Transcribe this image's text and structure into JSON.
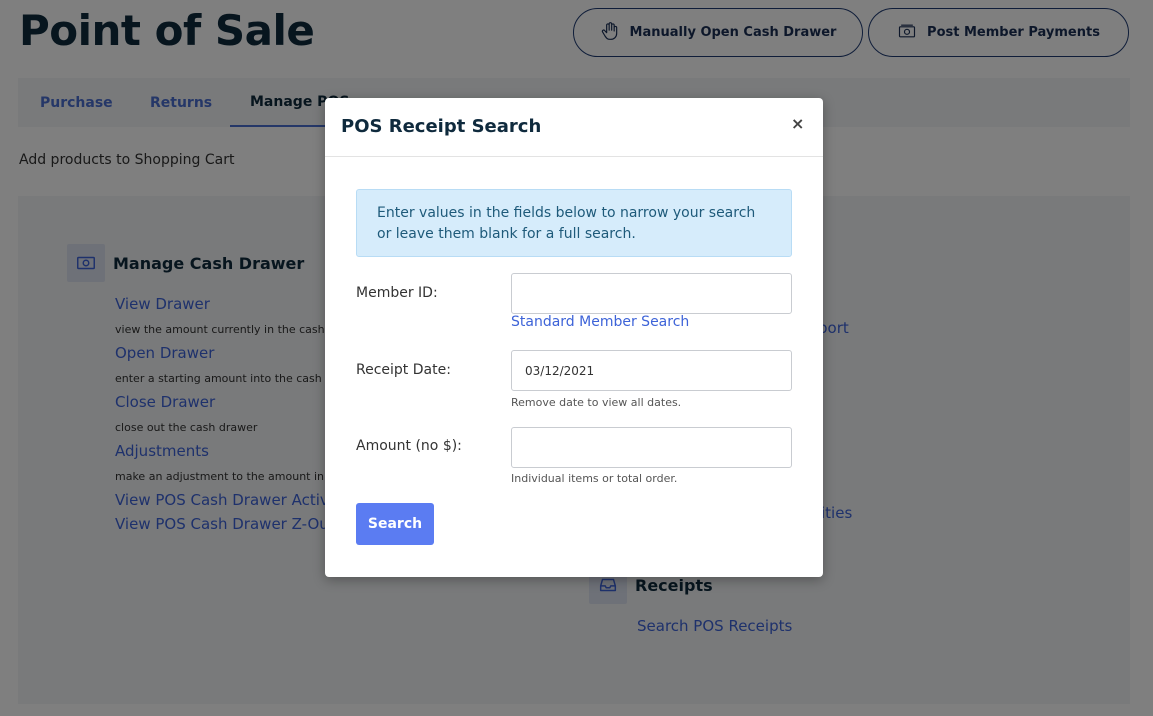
{
  "header": {
    "title": "Point of Sale",
    "open_drawer_label": "Manually Open Cash Drawer",
    "post_payments_label": "Post Member Payments"
  },
  "tabs": [
    {
      "label": "Purchase"
    },
    {
      "label": "Returns"
    },
    {
      "label": "Manage POS"
    }
  ],
  "subtitle": "Add products to Shopping Cart",
  "cash_drawer": {
    "title": "Manage Cash Drawer",
    "items": [
      {
        "label": "View Drawer",
        "desc": "view the amount currently in the cash drawer"
      },
      {
        "label": "Open Drawer",
        "desc": "enter a starting amount into the cash drawer"
      },
      {
        "label": "Close Drawer",
        "desc": "close out the cash drawer"
      },
      {
        "label": "Adjustments",
        "desc": "make an adjustment to the amount in the drawer"
      },
      {
        "label": "View POS Cash Drawer Activity"
      },
      {
        "label": "View POS Cash Drawer Z-Out"
      }
    ]
  },
  "right_links": {
    "report_fragment": "port",
    "activities_fragment": "ities"
  },
  "receipts": {
    "title": "Receipts",
    "search_link": "Search POS Receipts"
  },
  "modal": {
    "title": "POS Receipt Search",
    "close": "×",
    "info": "Enter values in the fields below to narrow your search or leave them blank for a full search.",
    "member_id_label": "Member ID:",
    "member_id_value": "",
    "member_search_link": "Standard Member Search",
    "receipt_date_label": "Receipt Date:",
    "receipt_date_value": "03/12/2021",
    "receipt_date_hint": "Remove date to view all dates.",
    "amount_label": "Amount (no $):",
    "amount_value": "",
    "amount_hint": "Individual items or total order.",
    "search_button": "Search"
  },
  "colors": {
    "accent": "#5b7cf2",
    "link": "#3d63d8",
    "title": "#0f2a3d",
    "info_bg": "#d6ecfb"
  }
}
